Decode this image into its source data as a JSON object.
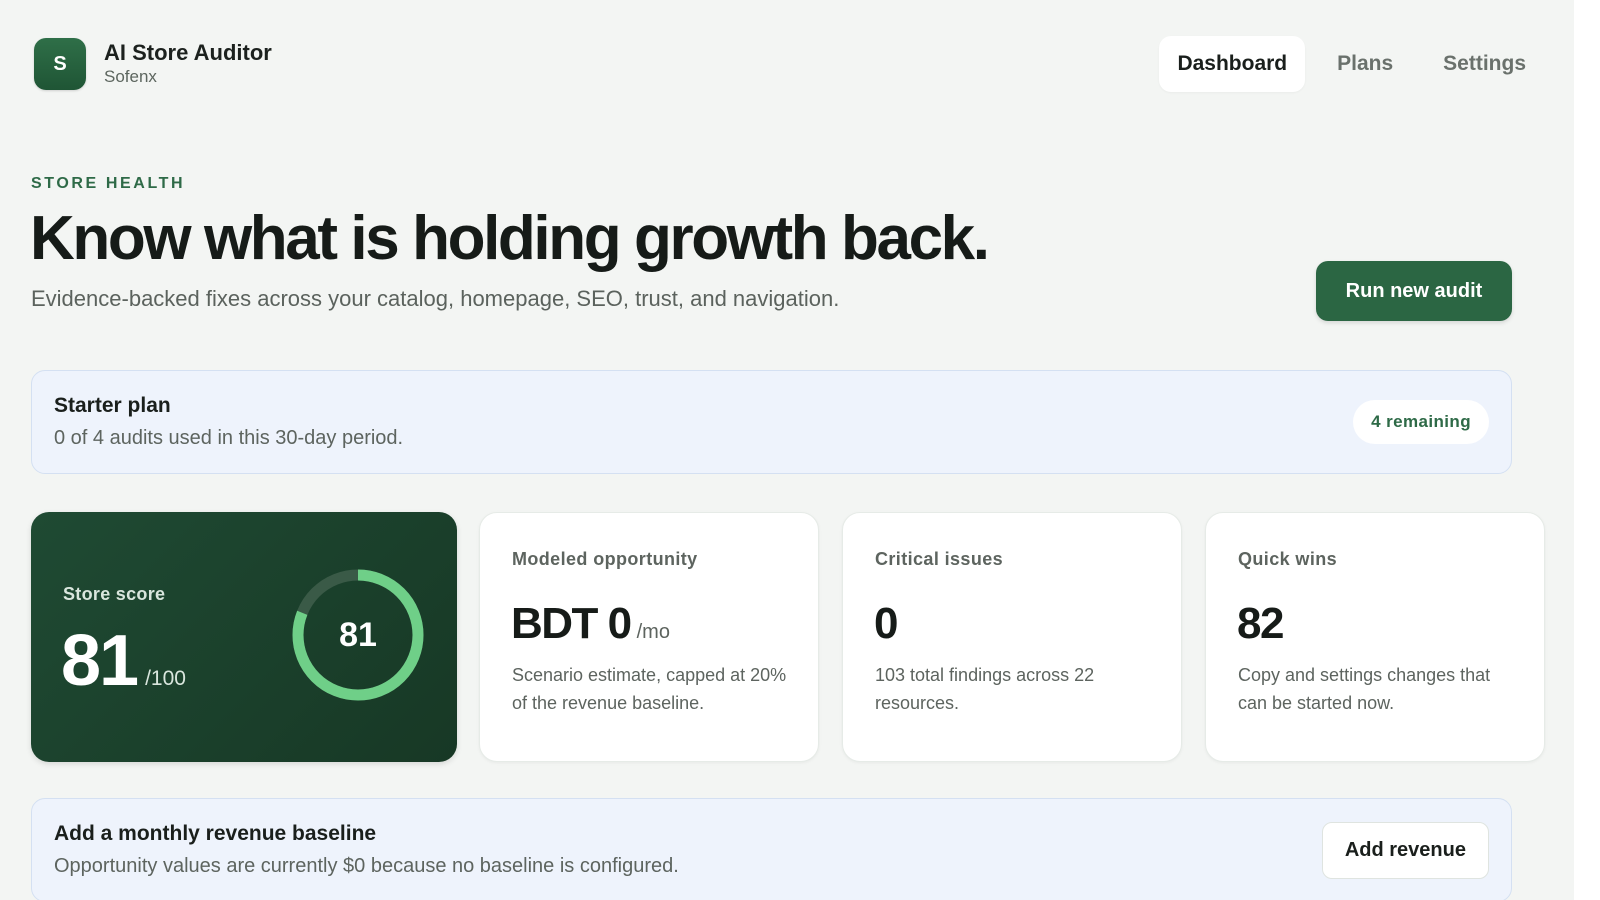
{
  "app": {
    "logo_letter": "S",
    "name": "AI Store Auditor",
    "org": "Sofenx"
  },
  "nav": {
    "items": [
      {
        "label": "Dashboard",
        "active": true
      },
      {
        "label": "Plans",
        "active": false
      },
      {
        "label": "Settings",
        "active": false
      }
    ]
  },
  "hero": {
    "eyebrow": "STORE HEALTH",
    "title": "Know what is holding growth back.",
    "subtitle": "Evidence-backed fixes across your catalog, homepage, SEO, trust, and navigation.",
    "action_label": "Run new audit"
  },
  "plan_banner": {
    "title": "Starter plan",
    "description": "0 of 4 audits used in this 30-day period.",
    "badge": "4 remaining"
  },
  "score_card": {
    "label": "Store score",
    "value": "81",
    "unit": "/100",
    "ring_value": "81",
    "ring_fraction": 0.81
  },
  "stats": [
    {
      "label": "Modeled opportunity",
      "value": "BDT 0",
      "suffix": "/mo",
      "description": "Scenario estimate, capped at 20% of the revenue baseline."
    },
    {
      "label": "Critical issues",
      "value": "0",
      "suffix": "",
      "description": "103 total findings across 22 resources."
    },
    {
      "label": "Quick wins",
      "value": "82",
      "suffix": "",
      "description": "Copy and settings changes that can be started now."
    }
  ],
  "revenue_banner": {
    "title": "Add a monthly revenue baseline",
    "description": "Opportunity values are currently $0 because no baseline is configured.",
    "action_label": "Add revenue"
  },
  "colors": {
    "accent": "#2b6643",
    "score_card_bg": "#1f4a33",
    "ring_progress": "#6fcf88",
    "ring_track": "#3a5a47",
    "banner_bg": "#eef3fc"
  }
}
